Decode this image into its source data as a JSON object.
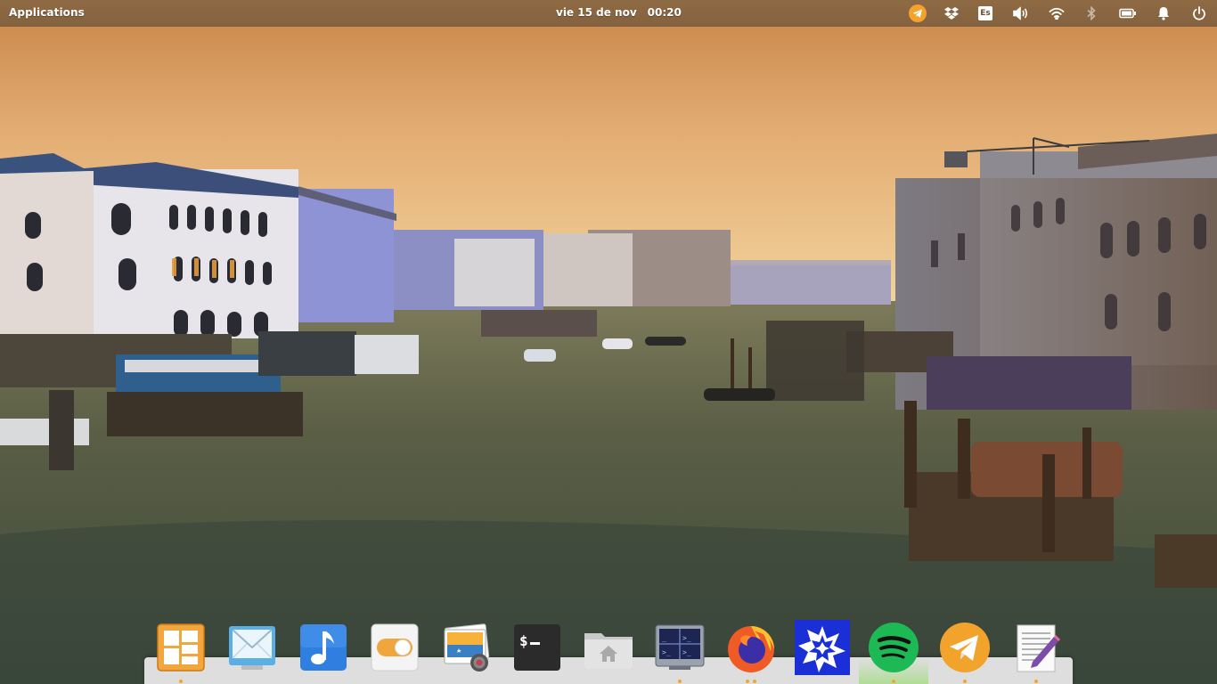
{
  "panel": {
    "applications_label": "Applications",
    "date": "vie 15 de nov",
    "time": "00:20",
    "keyboard_layout": "Es",
    "indicators": [
      "telegram-tray-icon",
      "dropbox-icon",
      "keyboard-layout-indicator",
      "volume-icon",
      "wifi-icon",
      "bluetooth-icon",
      "battery-icon",
      "notifications-bell-icon",
      "power-icon"
    ]
  },
  "dock": {
    "items": [
      {
        "name": "multitasking-view",
        "icon": "multitasking-icon",
        "running": true
      },
      {
        "name": "mail",
        "icon": "mail-icon",
        "running": false
      },
      {
        "name": "music",
        "icon": "music-icon",
        "running": false
      },
      {
        "name": "system-settings",
        "icon": "switchboard-toggle-icon",
        "running": false
      },
      {
        "name": "photos",
        "icon": "photos-icon",
        "running": false
      },
      {
        "name": "terminal",
        "icon": "terminal-icon",
        "running": false
      },
      {
        "name": "files",
        "icon": "files-home-icon",
        "running": false
      },
      {
        "name": "remote-terminal",
        "icon": "remote-terminal-icon",
        "running": true
      },
      {
        "name": "firefox",
        "icon": "firefox-icon",
        "running": true
      },
      {
        "name": "wolfram",
        "icon": "wolfram-star-icon",
        "running": false
      },
      {
        "name": "spotify",
        "icon": "spotify-icon",
        "running": true
      },
      {
        "name": "telegram",
        "icon": "telegram-icon",
        "running": true
      },
      {
        "name": "text-editor",
        "icon": "text-editor-icon",
        "running": true
      }
    ]
  },
  "colors": {
    "panel_bg": "#8e6a44",
    "accent_dot": "#f5a623",
    "sky_top": "#cc8b50",
    "sky_horizon": "#f0cf9a",
    "water": "#4a5238"
  }
}
